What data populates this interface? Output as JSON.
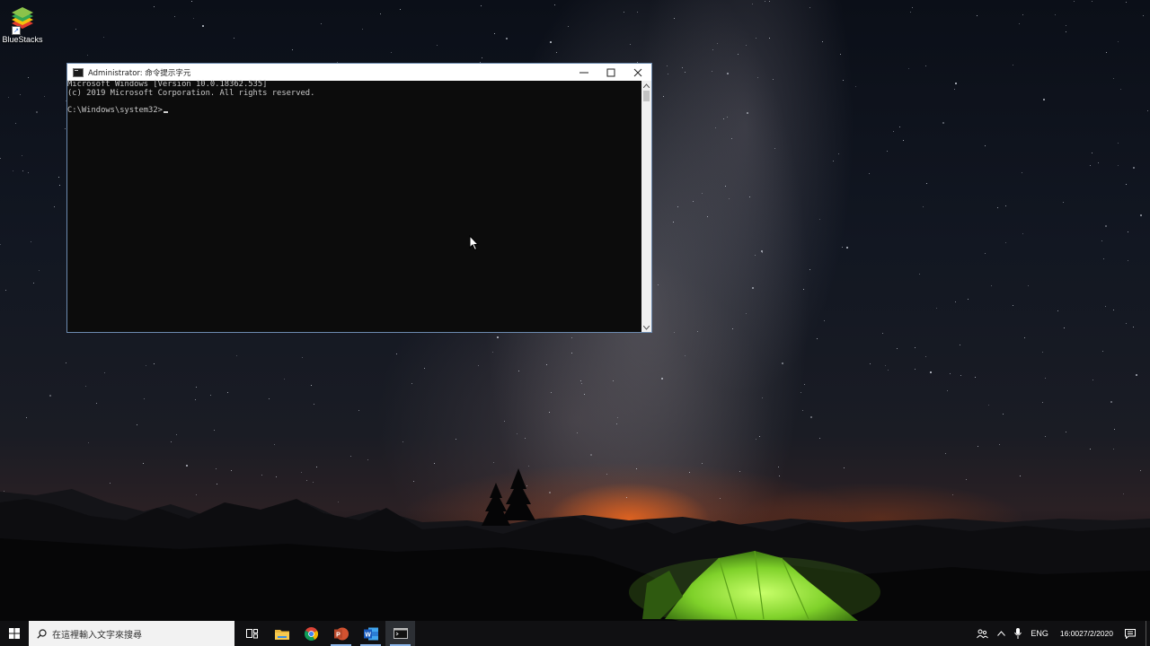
{
  "desktop": {
    "icons": [
      {
        "label": "BlueStacks",
        "icon": "bluestacks-icon"
      }
    ]
  },
  "cmd_window": {
    "title": "Administrator: 命令提示字元",
    "icon": "console-icon",
    "lines": [
      "Microsoft Windows [Version 10.0.18362.535]",
      "(c) 2019 Microsoft Corporation. All rights reserved.",
      "",
      "C:\\Windows\\system32>"
    ]
  },
  "taskbar": {
    "search_placeholder": "在這裡輸入文字來搜尋",
    "pinned": [
      {
        "name": "task-view",
        "icon": "task-view-icon"
      },
      {
        "name": "file-explorer",
        "icon": "folder-icon"
      },
      {
        "name": "chrome",
        "icon": "chrome-icon"
      },
      {
        "name": "powerpoint",
        "icon": "powerpoint-icon"
      },
      {
        "name": "word",
        "icon": "word-icon"
      },
      {
        "name": "command-prompt",
        "icon": "console-icon",
        "active": true
      }
    ],
    "tray": {
      "language": "ENG",
      "time": "16:00",
      "date": "27/2/2020"
    }
  },
  "colors": {
    "console_bg": "#0c0c0c",
    "console_text": "#c8c8c8",
    "taskbar_bg": "#101012",
    "active_indicator": "#8ab4e8"
  }
}
